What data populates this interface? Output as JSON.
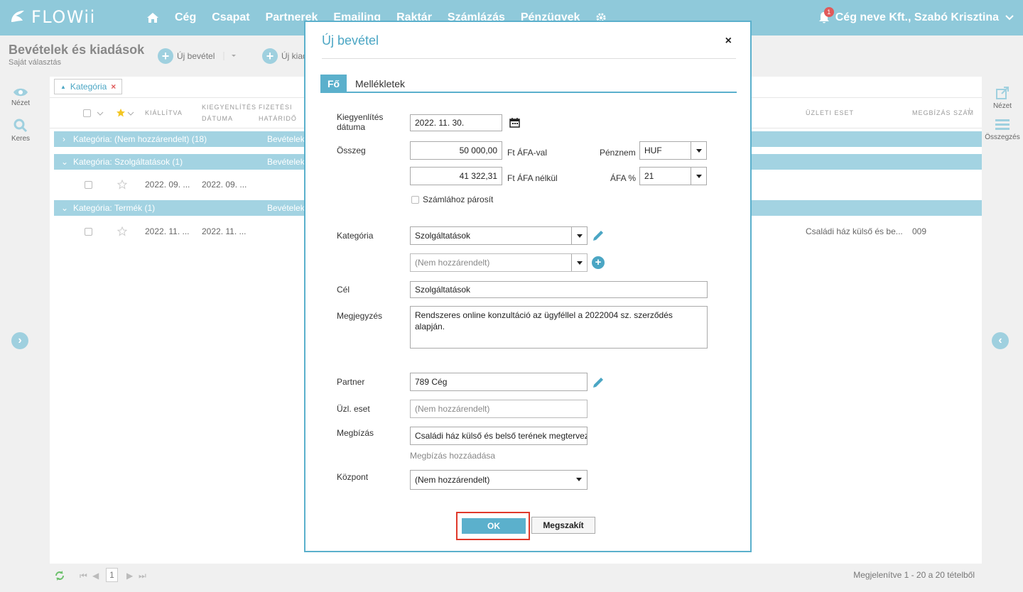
{
  "app": {
    "logo": "FLOWii"
  },
  "nav": {
    "items": [
      "Cég",
      "Csapat",
      "Partnerek",
      "Emailing",
      "Raktár",
      "Számlázás",
      "Pénzügyek"
    ],
    "notifications": "1",
    "company_user": "Cég neve Kft., Szabó Krisztina"
  },
  "page": {
    "title": "Bevételek és kiadások",
    "subtitle": "Saját választás",
    "new_income": "Új bevétel",
    "new_expense": "Új kiad"
  },
  "left_sidebar": {
    "view": "Nézet",
    "search": "Keres"
  },
  "right_sidebar": {
    "view": "Nézet",
    "summary": "Összegzés"
  },
  "filter": {
    "chip": "Kategória"
  },
  "columns": {
    "issued": "KIÁLLÍTVA",
    "settle_1": "KIEGYENLÍTÉS",
    "settle_2": "DÁTUMA",
    "due_1": "FIZETÉSI",
    "due_2": "HATÁRIDŐ",
    "business_case": "ÜZLETI ESET",
    "order": "MEGBÍZÁS SZÁM"
  },
  "groups": [
    {
      "label": "Kategória: (Nem hozzárendelt) (18)",
      "type": "Bevételek"
    },
    {
      "label": "Kategória: Szolgáltatások (1)",
      "type": "Bevételek"
    },
    {
      "label": "Kategória: Termék (1)",
      "type": "Bevételek"
    }
  ],
  "rows": [
    {
      "issued": "2022. 09. ...",
      "settled": "2022. 09. ...",
      "business_case": "",
      "order": ""
    },
    {
      "issued": "2022. 11. ...",
      "settled": "2022. 11. ...",
      "business_case": "Családi ház külső és be...",
      "order": "009"
    }
  ],
  "footer": {
    "page": "1",
    "info": "Megjelenítve 1 - 20 a 20 tételből"
  },
  "modal": {
    "title": "Új bevétel",
    "close": "×",
    "tabs": [
      "Fő",
      "Mellékletek"
    ],
    "settle_label_1": "Kiegyenlítés",
    "settle_label_2": "dátuma",
    "settle_date": "2022. 11. 30.",
    "amount_label": "Összeg",
    "gross": "50 000,00",
    "gross_unit": "Ft ÁFA-val",
    "net": "41 322,31",
    "net_unit": "Ft ÁFA nélkül",
    "currency_label": "Pénznem",
    "currency": "HUF",
    "vat_label": "ÁFA %",
    "vat": "21",
    "pair_invoice": "Számlához párosít",
    "category_label": "Kategória",
    "category": "Szolgáltatások",
    "subcategory": "(Nem hozzárendelt)",
    "goal_label": "Cél",
    "goal": "Szolgáltatások",
    "note_label": "Megjegyzés",
    "note": "Rendszeres online konzultáció az ügyféllel a 2022004 sz. szerződés alapján.",
    "partner_label": "Partner",
    "partner": "789 Cég",
    "business_case_label": "Üzl. eset",
    "business_case": "(Nem hozzárendelt)",
    "order_label": "Megbízás",
    "order": "Családi ház külső és belső terének megtervezése",
    "add_order": "Megbízás hozzáadása",
    "center_label": "Központ",
    "center": "(Nem hozzárendelt)",
    "ok": "OK",
    "cancel": "Megszakít"
  }
}
